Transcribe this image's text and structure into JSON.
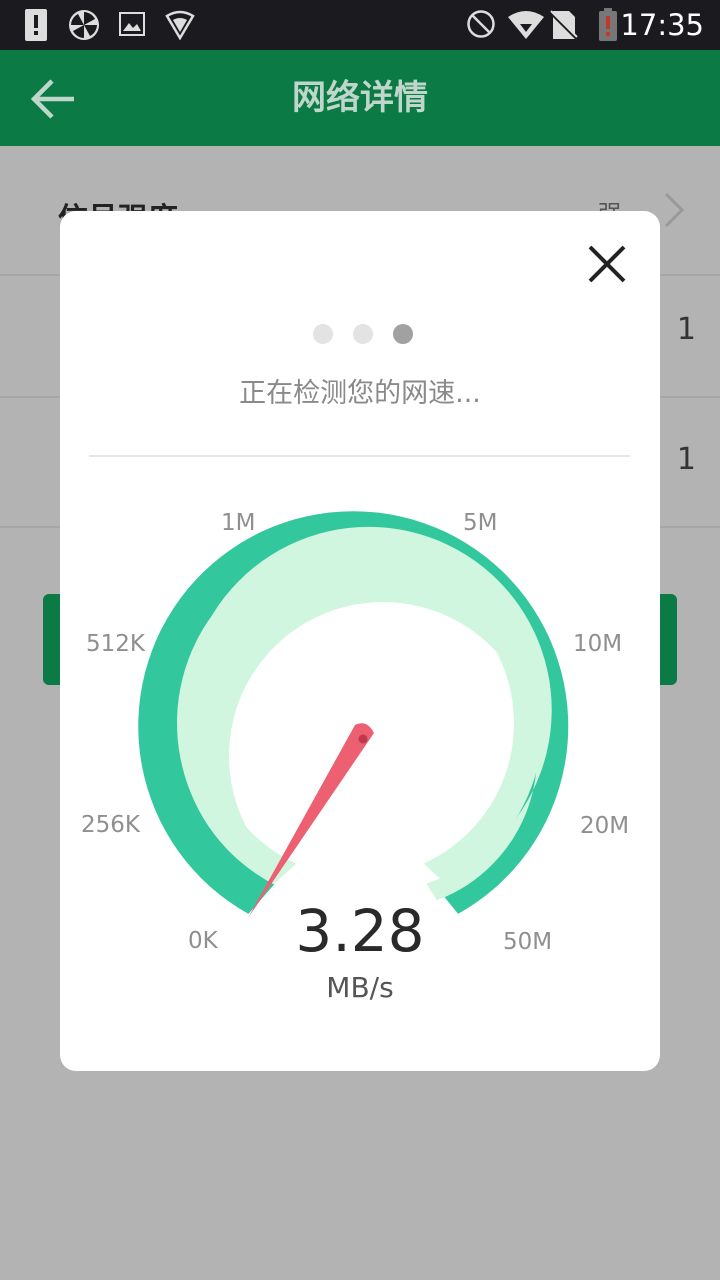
{
  "status_bar": {
    "time": "17:35",
    "icons": [
      "alert-icon",
      "pinwheel-icon",
      "image-icon",
      "shield-wifi-icon",
      "do-not-disturb-icon",
      "wifi-icon",
      "no-sim-icon",
      "battery-low-icon"
    ]
  },
  "app_bar": {
    "title": "网络详情",
    "back_icon": "back-arrow-icon"
  },
  "background": {
    "rows": [
      {
        "label": "信号强度",
        "value": "强"
      },
      {
        "label": "",
        "value": "1"
      },
      {
        "label": "",
        "value": "1"
      }
    ]
  },
  "dialog": {
    "close_icon": "close-icon",
    "progress_dots": {
      "count": 3,
      "active_index": 2
    },
    "status_text": "正在检测您的网速...",
    "gauge": {
      "labels": [
        "0K",
        "256K",
        "512K",
        "1M",
        "5M",
        "10M",
        "20M",
        "50M"
      ]
    },
    "speed_value": "3.28",
    "speed_unit": "MB/s"
  },
  "colors": {
    "primary_green": "#0b7a45",
    "gauge_outer": "#33c79e",
    "gauge_inner": "#d1f6df",
    "needle": "#ec6072"
  }
}
